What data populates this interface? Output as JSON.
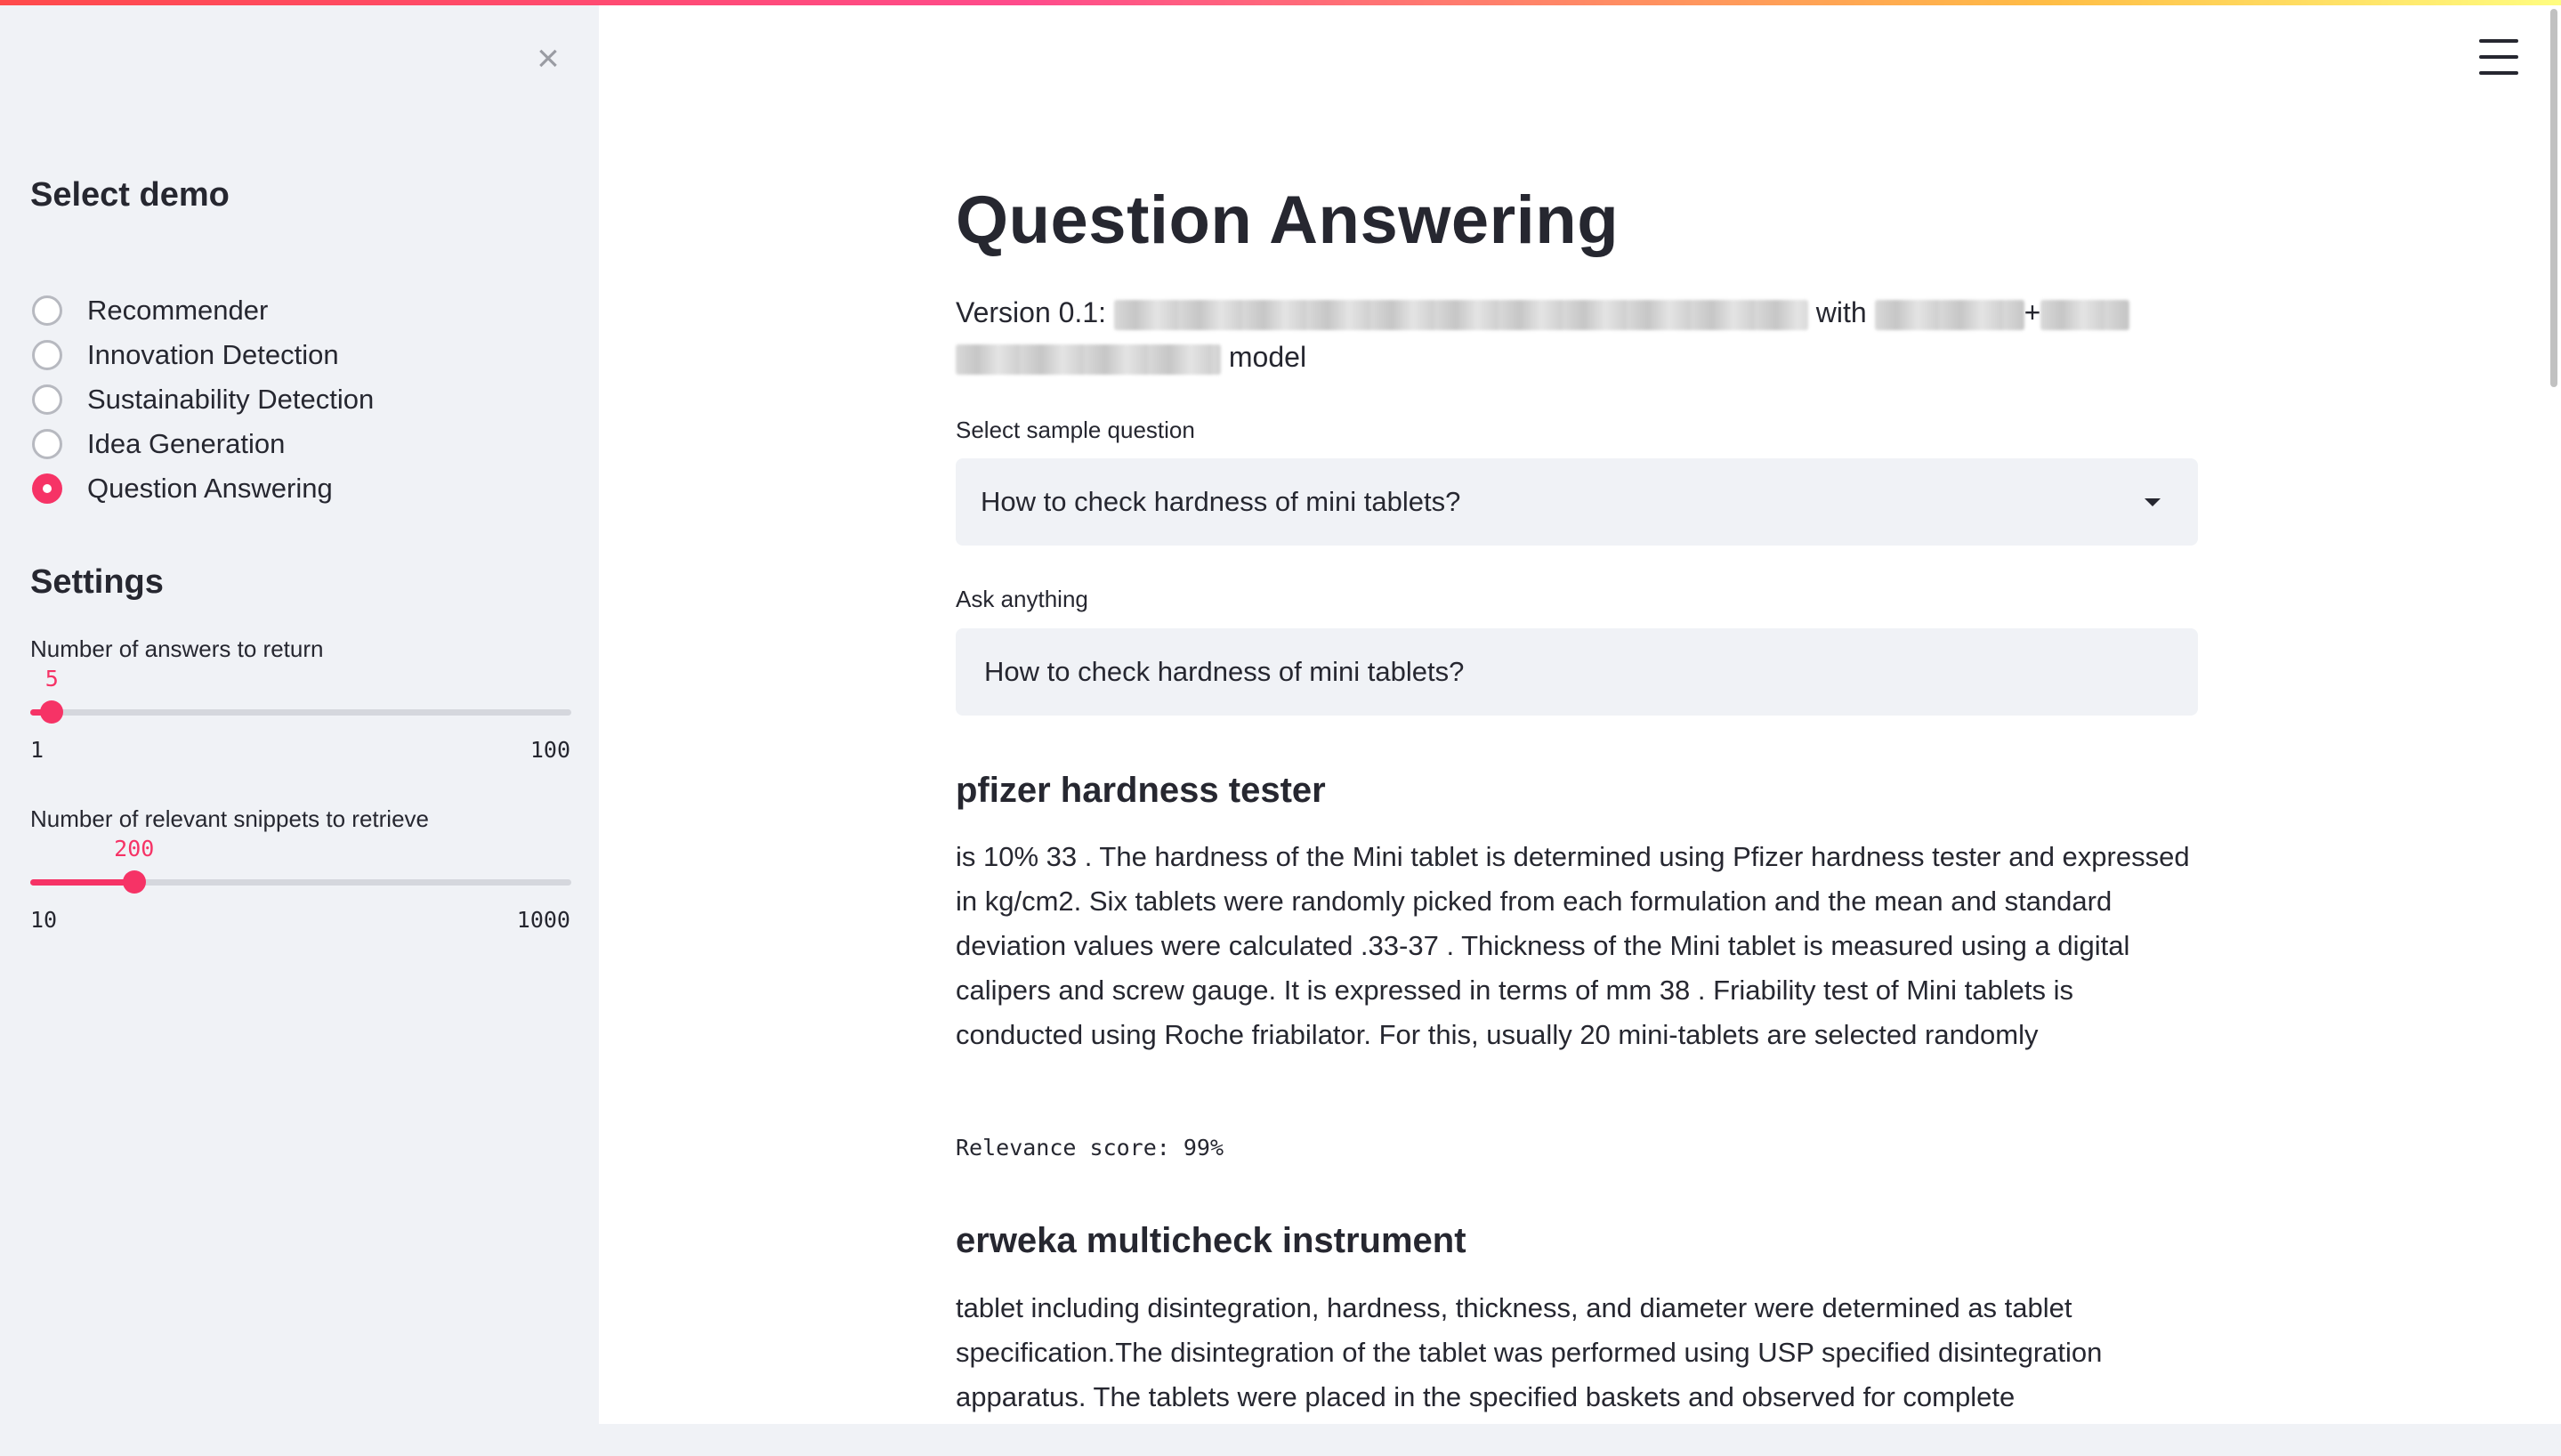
{
  "sidebar": {
    "close_icon": "×",
    "select_demo_heading": "Select demo",
    "demos": [
      {
        "label": "Recommender",
        "selected": false
      },
      {
        "label": "Innovation Detection",
        "selected": false
      },
      {
        "label": "Sustainability Detection",
        "selected": false
      },
      {
        "label": "Idea Generation",
        "selected": false
      },
      {
        "label": "Question Answering",
        "selected": true
      }
    ],
    "settings_heading": "Settings",
    "sliders": [
      {
        "label": "Number of answers to return",
        "value": "5",
        "min": "1",
        "max": "100",
        "fraction": 0.04
      },
      {
        "label": "Number of relevant snippets to retrieve",
        "value": "200",
        "min": "10",
        "max": "1000",
        "fraction": 0.192
      }
    ]
  },
  "header": {
    "menu_icon": "hamburger-menu-icon"
  },
  "main": {
    "title": "Question Answering",
    "version_prefix": "Version 0.1:",
    "version_with": "with",
    "version_plus": "+",
    "version_model": "model",
    "sample_question_label": "Select sample question",
    "sample_question_value": "How to check hardness of mini tablets?",
    "ask_label": "Ask anything",
    "ask_value": "How to check hardness of mini tablets?",
    "answers": [
      {
        "title": "pfizer hardness tester",
        "text": "is 10% 33 . The hardness of the Mini tablet is determined using Pfizer hardness tester and expressed in kg/cm2. Six tablets were randomly picked from each formulation and the mean and standard deviation values were calculated .33-37 . Thickness of the Mini tablet is measured using a digital calipers and screw gauge. It is expressed in terms of mm 38 . Friability test of Mini tablets is conducted using Roche friabilator. For this, usually 20 mini-tablets are selected randomly",
        "relevance": "Relevance score: 99%"
      },
      {
        "title": "erweka multicheck instrument",
        "text": "tablet including disintegration, hardness, thickness, and diameter were determined as tablet specification.The disintegration of the tablet was performed using USP specified disintegration apparatus. The tablets were placed in the specified baskets and observed for complete"
      }
    ]
  },
  "colors": {
    "accent": "#f63366",
    "sidebar_bg": "#f0f2f6",
    "text": "#262730"
  }
}
